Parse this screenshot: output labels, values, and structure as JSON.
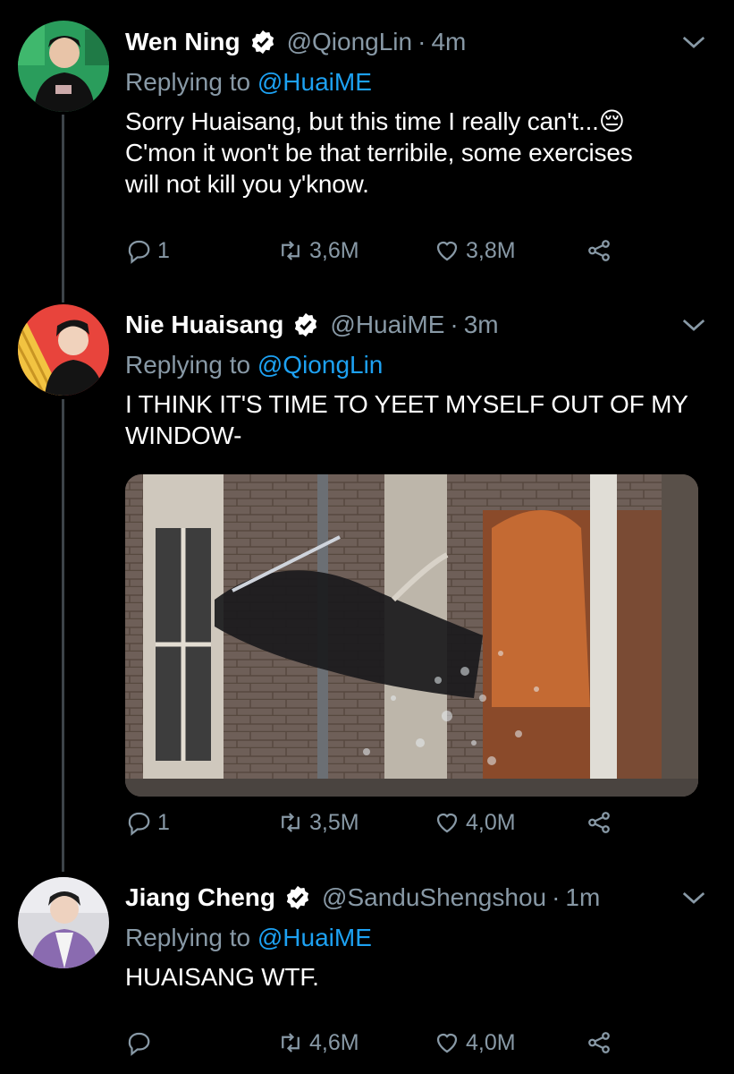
{
  "tweets": [
    {
      "name": "Wen Ning",
      "handle": "@QiongLin",
      "time": "4m",
      "replying_prefix": "Replying to",
      "replying_to": "@HuaiME",
      "text_lines": [
        "Sorry Huaisang, but this time I really can't...😔",
        "C'mon it won't be that terribile, some exercises",
        "will not kill you y'know."
      ],
      "replies": "1",
      "retweets": "3,6M",
      "likes": "3,8M"
    },
    {
      "name": "Nie Huaisang",
      "handle": "@HuaiME",
      "time": "3m",
      "replying_prefix": "Replying to",
      "replying_to": "@QiongLin",
      "text_lines": [
        "I THINK IT'S TIME TO YEET MYSELF OUT OF MY",
        "WINDOW-"
      ],
      "replies": "1",
      "retweets": "3,5M",
      "likes": "4,0M"
    },
    {
      "name": "Jiang Cheng",
      "handle": "@SanduShengshou",
      "time": "1m",
      "replying_prefix": "Replying to",
      "replying_to": "@HuaiME",
      "text_lines": [
        "HUAISANG WTF."
      ],
      "replies": "",
      "retweets": "4,6M",
      "likes": "4,0M"
    }
  ],
  "colors": {
    "accent": "#1da1f2",
    "muted": "#8899a6",
    "background": "#000000"
  },
  "icons": [
    "verified-badge-icon",
    "chevron-down-icon",
    "reply-icon",
    "retweet-icon",
    "like-icon",
    "share-icon"
  ]
}
